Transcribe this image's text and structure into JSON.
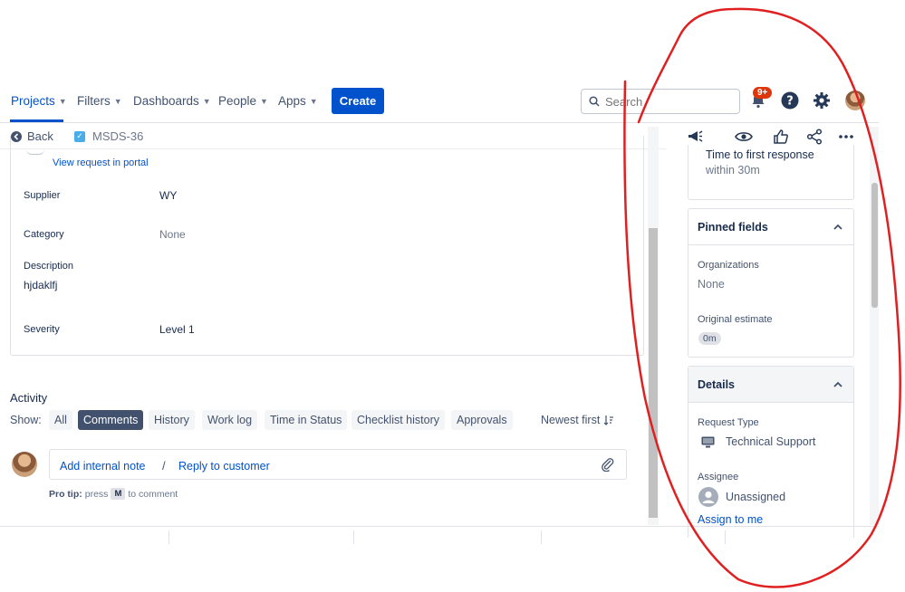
{
  "nav": {
    "items": [
      {
        "label": "Projects",
        "active": true
      },
      {
        "label": "Filters"
      },
      {
        "label": "Dashboards"
      },
      {
        "label": "People"
      },
      {
        "label": "Apps"
      }
    ],
    "create_label": "Create",
    "search_placeholder": "Search",
    "notification_count": "9+",
    "icons": [
      "notification-icon",
      "help-icon",
      "settings-icon",
      "avatar"
    ]
  },
  "breadcrumb": {
    "back_label": "Back",
    "issue_key": "MSDS-36"
  },
  "fields": {
    "portal_link": "View request in portal",
    "supplier_label": "Supplier",
    "supplier_value": "WY",
    "category_label": "Category",
    "category_value": "None",
    "description_label": "Description",
    "description_value": "hjdaklfj",
    "severity_label": "Severity",
    "severity_value": "Level 1"
  },
  "activity": {
    "heading": "Activity",
    "show_label": "Show:",
    "filters": [
      "All",
      "Comments",
      "History",
      "Work log",
      "Time in Status",
      "Checklist history",
      "Approvals"
    ],
    "selected_filter": "Comments",
    "sort_label": "Newest first",
    "comment": {
      "internal_note": "Add internal note",
      "separator": "/",
      "reply": "Reply to customer"
    },
    "protip": {
      "prefix": "Pro tip:",
      "press": "press",
      "key": "M",
      "suffix": "to comment"
    }
  },
  "side_panel": {
    "sla": {
      "label": "Time to first response",
      "value": "within 30m"
    },
    "pinned": {
      "title": "Pinned fields",
      "organizations_label": "Organizations",
      "organizations_value": "None",
      "estimate_label": "Original estimate",
      "estimate_value": "0m"
    },
    "details": {
      "title": "Details",
      "request_type_label": "Request Type",
      "request_type_value": "Technical Support",
      "assignee_label": "Assignee",
      "assignee_value": "Unassigned",
      "assign_to_me": "Assign to me"
    }
  },
  "colors": {
    "brand": "#0052cc",
    "annotation": "#e02020",
    "badge": "#de350b"
  }
}
